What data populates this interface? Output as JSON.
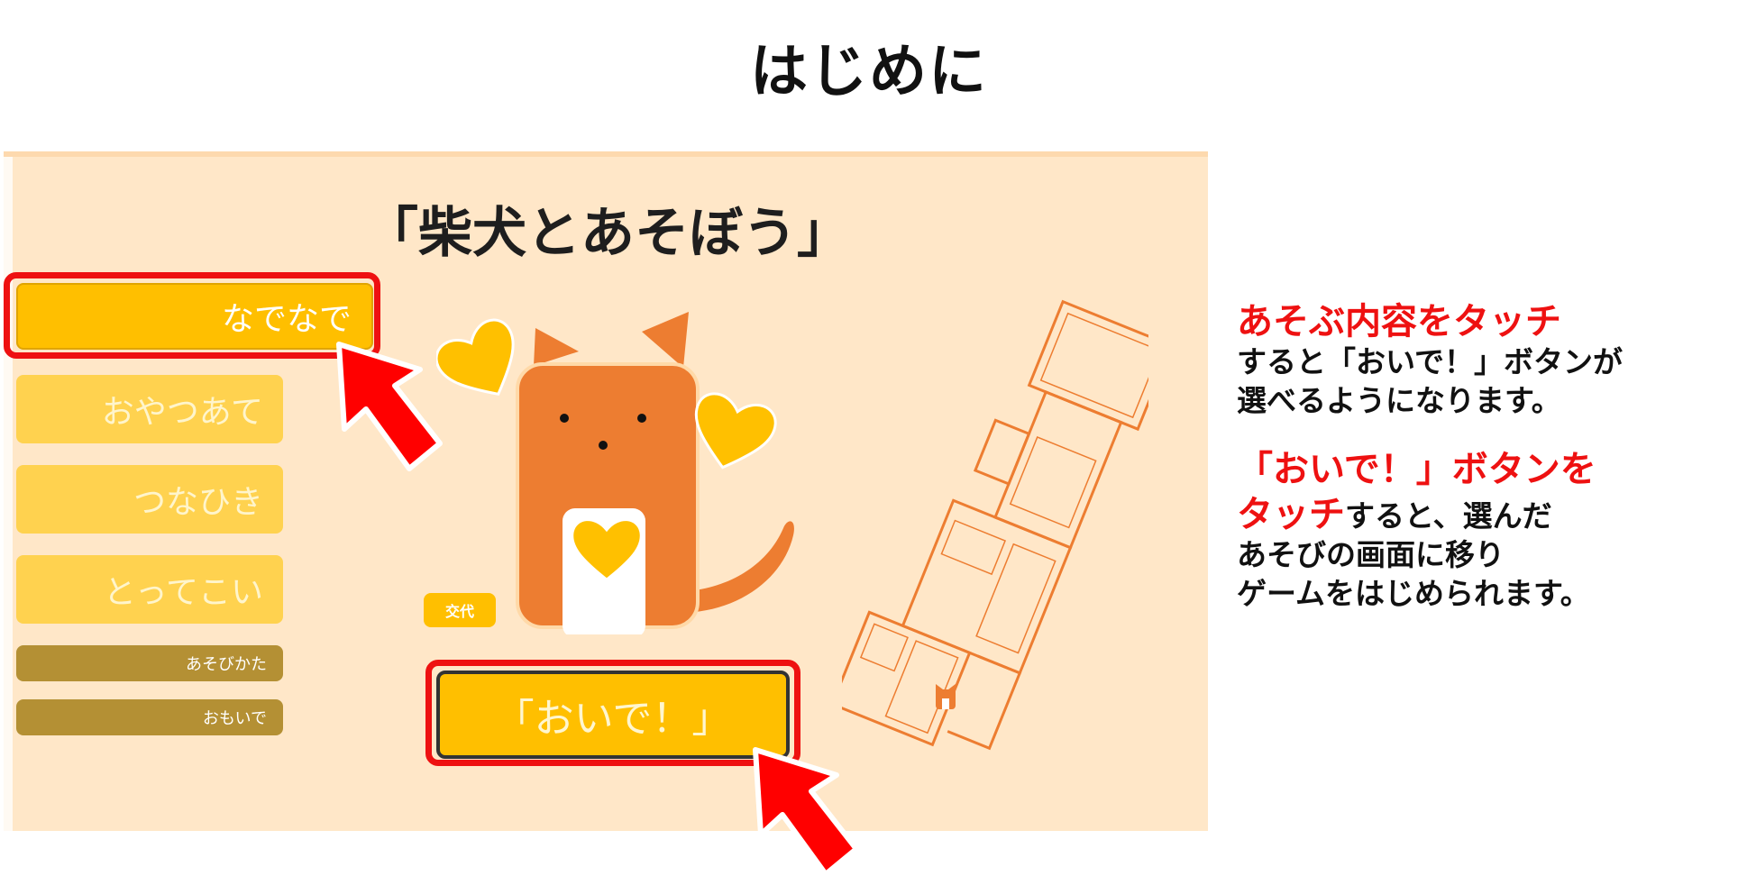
{
  "page": {
    "title": "はじめに"
  },
  "app": {
    "title": "「柴犬とあそぼう」",
    "menu": [
      {
        "label": "なでなで",
        "selected": true
      },
      {
        "label": "おやつあて",
        "selected": false
      },
      {
        "label": "つなひき",
        "selected": false
      },
      {
        "label": "とってこい",
        "selected": false
      }
    ],
    "sub_menu": [
      {
        "label": "あそびかた"
      },
      {
        "label": "おもいで"
      }
    ],
    "change_button": "交代",
    "call_button": "「おいで！」"
  },
  "instructions": {
    "block1_red": "あそぶ内容をタッチ",
    "block1_line2": "すると「おいで！」ボタンが",
    "block1_line3": "選べるようになります。",
    "block2_red_line1": "「おいで！」ボタンを",
    "block2_red_line2": "タッチ",
    "block2_line2_rest": "すると、選んだ",
    "block2_line3": "あそびの画面に移り",
    "block2_line4": "ゲームをはじめられます。"
  },
  "colors": {
    "accent_red": "#ee1111",
    "button_yellow": "#ffbf00",
    "dog_orange": "#ed7d31",
    "background": "#ffe7c8"
  },
  "icons": [
    "heart-icon",
    "shiba-dog-character",
    "floor-plan-map",
    "pointer-arrow-icon"
  ]
}
